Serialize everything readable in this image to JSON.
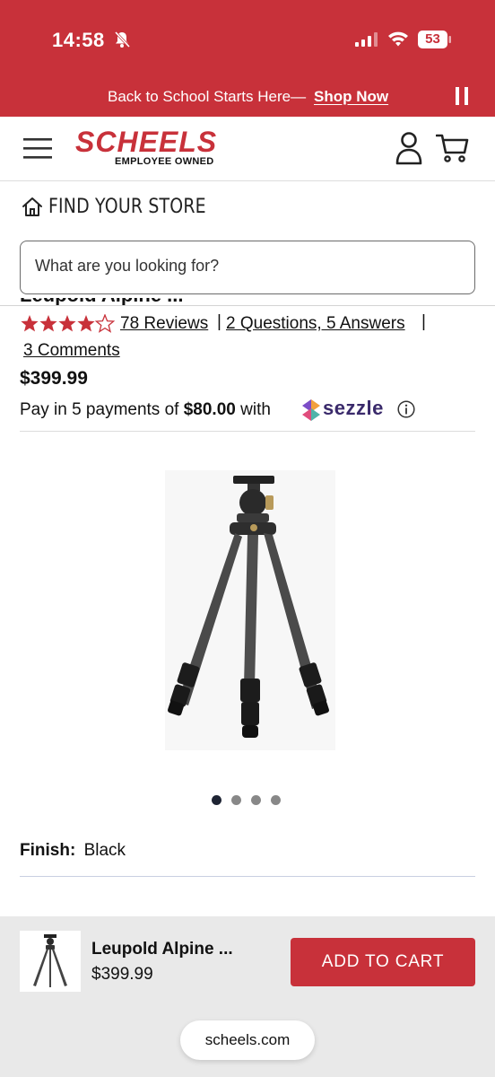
{
  "status_bar": {
    "time": "14:58",
    "battery": "53"
  },
  "promo": {
    "text": "Back to School Starts Here—",
    "link": "Shop Now"
  },
  "header": {
    "logo": "SCHEELS",
    "logo_sub": "EMPLOYEE OWNED"
  },
  "store": {
    "label": "FIND YOUR STORE"
  },
  "search": {
    "placeholder": "What are you looking for?"
  },
  "product": {
    "rating": 4.5,
    "reviews": "78 Reviews",
    "questions": "2 Questions, 5 Answers",
    "comments": "3 Comments",
    "price": "$399.99",
    "installment_prefix": "Pay in 5 payments of",
    "installment_amount": "$80.00",
    "installment_with": "with",
    "installment_provider": "sezzle",
    "image_count": 4,
    "image_index": 1,
    "finish_label": "Finish:",
    "finish_value": "Black"
  },
  "sticky": {
    "name": "Leupold Alpine ...",
    "price": "$399.99",
    "button": "ADD TO CART"
  },
  "browser": {
    "url": "scheels.com"
  },
  "colors": {
    "brand": "#c8313a",
    "text": "#111111"
  }
}
